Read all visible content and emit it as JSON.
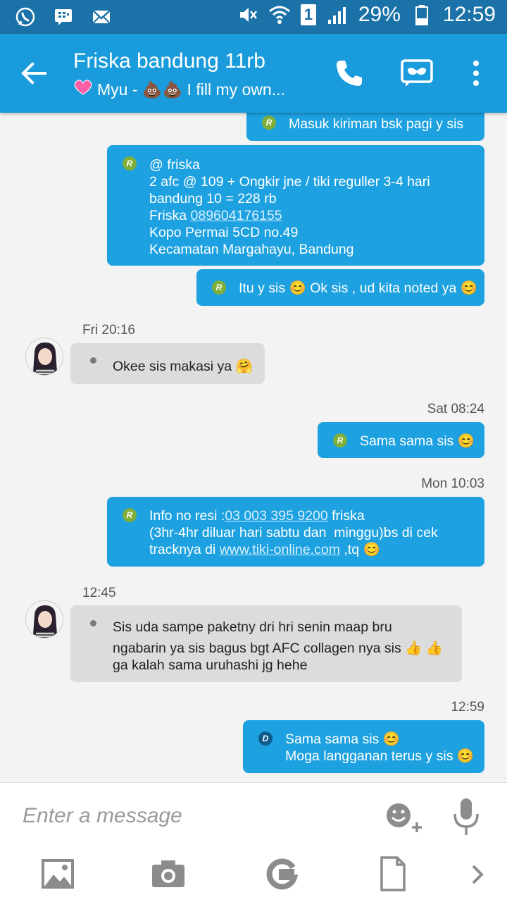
{
  "status_bar": {
    "battery": "29%",
    "time": "12:59",
    "sim": "1",
    "icons": [
      "whatsapp-icon",
      "bbm-icon",
      "mail-icon",
      "mute-icon",
      "wifi-icon",
      "signal-icon",
      "battery-icon"
    ]
  },
  "header": {
    "title": "Friska bandung 11rb",
    "subtitle": "Myu - 💩💩 I fill my own...",
    "icons": [
      "back-arrow-icon",
      "phone-icon",
      "mask-icon",
      "more-vert-icon"
    ]
  },
  "messages": [
    {
      "dir": "out",
      "badge": "R",
      "lines": [
        "Masuk kiriman bsk pagi y sis"
      ]
    },
    {
      "dir": "out",
      "badge": "R",
      "lines": [
        "@ friska",
        "2 afc @ 109 + Ongkir jne / tiki reguller 3-4 hari",
        "bandung 10 = 228 rb",
        "Friska ",
        "Kopo Permai 5CD no.49",
        "Kecamatan Margahayu, Bandung"
      ],
      "phone_link": "089604176155"
    },
    {
      "dir": "out",
      "badge": "R",
      "lines": [
        "Itu y sis 😊 Ok sis , ud kita noted ya 😊"
      ]
    },
    {
      "timestamp": "Fri 20:16"
    },
    {
      "dir": "in",
      "lines": [
        "Okee sis makasi ya 🤗"
      ]
    },
    {
      "timestamp": "Sat 08:24"
    },
    {
      "dir": "out",
      "badge": "R",
      "lines": [
        "Sama sama sis 😊"
      ]
    },
    {
      "timestamp": "Mon 10:03"
    },
    {
      "dir": "out",
      "badge": "R",
      "lines": [
        "Info no resi :",
        " friska",
        "(3hr-4hr diluar hari sabtu dan  minggu)bs di cek",
        "tracknya di ",
        " ,tq 😊"
      ],
      "resi_link": "03 003 395 9200",
      "web_link": "www.tiki-online.com"
    },
    {
      "timestamp": "12:45"
    },
    {
      "dir": "in",
      "lines": [
        "Sis uda sampe paketny dri hri senin maap bru",
        "ngabarin ya sis bagus bgt AFC collagen nya sis 👍 👍",
        "ga kalah sama uruhashi jg hehe"
      ]
    },
    {
      "timestamp": "12:59"
    },
    {
      "dir": "out",
      "badge": "D",
      "lines": [
        "Sama sama sis 😊",
        "Moga langganan terus y sis 😊"
      ]
    }
  ],
  "input": {
    "placeholder": "Enter a message",
    "icons": [
      "emoji-add-icon",
      "microphone-icon",
      "gallery-icon",
      "camera-icon",
      "google-icon",
      "document-icon",
      "chevron-right-icon"
    ]
  },
  "colors": {
    "appbar": "#1a9bdb",
    "statusbar": "#1a72a8",
    "outgoing": "#1da1e0",
    "incoming": "#dcdcdc",
    "badge_r": "#7fae3a",
    "badge_d": "#0f5a8c"
  }
}
